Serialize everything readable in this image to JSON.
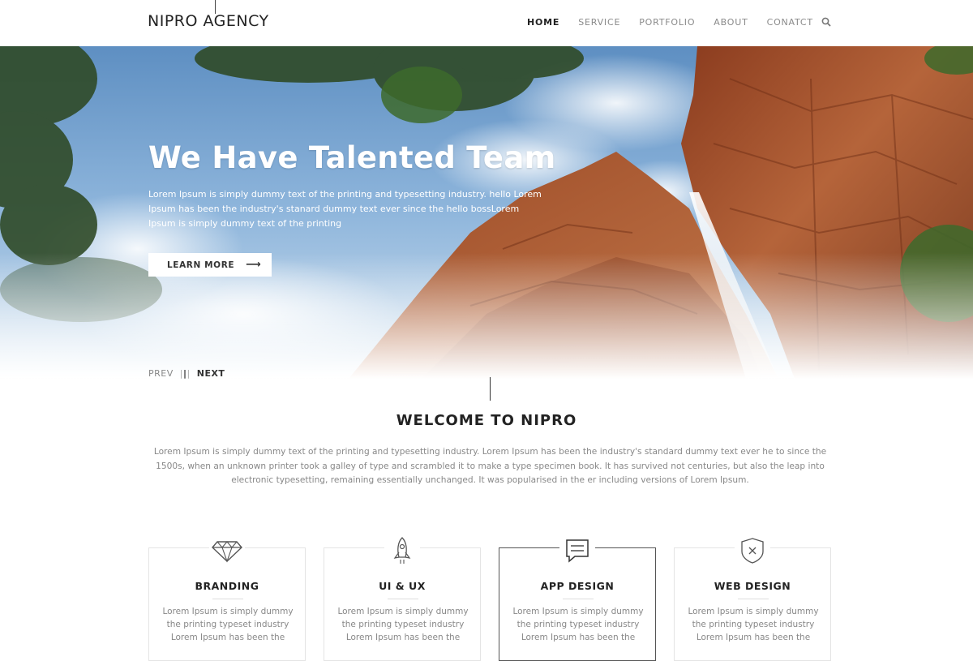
{
  "header": {
    "logo": "NIPRO AGENCY",
    "nav": [
      "HOME",
      "SERVICE",
      "PORTFOLIO",
      "ABOUT",
      "CONATCT"
    ],
    "active_index": 0,
    "search_icon": "search-icon"
  },
  "hero": {
    "title": "We Have Talented Team",
    "text": "Lorem Ipsum is simply dummy text of the printing and typesetting industry. hello Lorem Ipsum has been the industry's stanard dummy text ever since the  hello  bossLorem Ipsum is simply dummy text of the printing",
    "button_label": "LEARN MORE",
    "button_icon": "arrow-right-icon"
  },
  "slider": {
    "prev": "PREV",
    "next": "NEXT"
  },
  "welcome": {
    "title": "WELCOME TO NIPRO",
    "text": "Lorem Ipsum is simply dummy text of the printing and typesetting industry. Lorem Ipsum has been the industry's standard dummy text ever he to since the 1500s, when an unknown printer took a galley of type and scrambled it to make a type specimen book. It has survived not  centuries, but also the leap into electronic typesetting, remaining essentially unchanged. It was popularised in the er including versions of Lorem Ipsum."
  },
  "services": [
    {
      "title": "BRANDING",
      "icon": "diamond-icon",
      "text": "Lorem Ipsum is simply dummy the printing typeset industry Lorem Ipsum has been the"
    },
    {
      "title": "UI & UX",
      "icon": "rocket-icon",
      "text": "Lorem Ipsum is simply dummy the printing typeset industry Lorem Ipsum has been the"
    },
    {
      "title": "APP DESIGN",
      "icon": "chat-icon",
      "text": "Lorem Ipsum is simply dummy the printing typeset industry Lorem Ipsum has been the"
    },
    {
      "title": "WEB DESIGN",
      "icon": "shield-icon",
      "text": "Lorem Ipsum is simply dummy the printing typeset industry Lorem Ipsum has been the"
    }
  ],
  "colors": {
    "text_dark": "#222222",
    "text_muted": "#888888",
    "sky": "#6a9fcf",
    "rock": "#a0522d"
  }
}
